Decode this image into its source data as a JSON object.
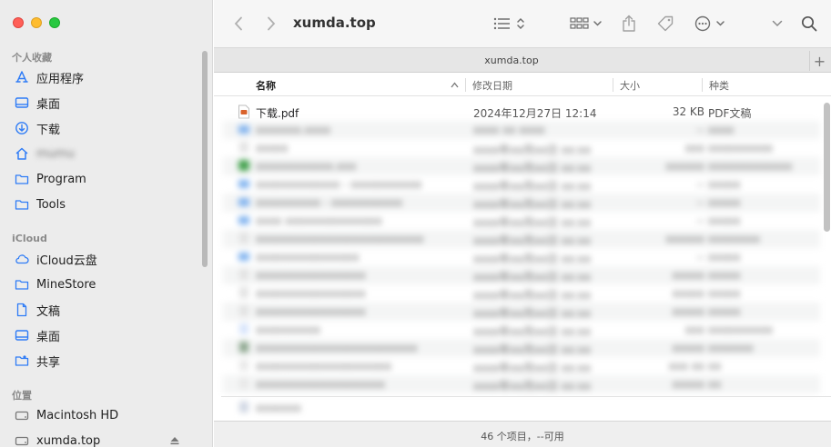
{
  "window": {
    "title": "xumda.top",
    "tab_title": "xumda.top",
    "status": "46 个项目，--可用"
  },
  "toolbar": {
    "back_icon": "chevron-left-icon",
    "forward_icon": "chevron-right-icon",
    "view_icon": "list-view-icon",
    "group_icon": "grid-group-icon",
    "share_icon": "share-icon",
    "tag_icon": "tag-icon",
    "action_icon": "ellipsis-circle-icon",
    "search_icon": "search-icon",
    "tab_add_label": "+"
  },
  "sidebar": {
    "favorites_header": "个人收藏",
    "favorites": [
      {
        "label": "应用程序",
        "icon": "applications-icon"
      },
      {
        "label": "桌面",
        "icon": "desktop-icon"
      },
      {
        "label": "下载",
        "icon": "download-icon"
      },
      {
        "label": "mumu",
        "icon": "home-icon"
      },
      {
        "label": "Program",
        "icon": "folder-icon"
      },
      {
        "label": "Tools",
        "icon": "folder-icon"
      }
    ],
    "icloud_header": "iCloud",
    "icloud": [
      {
        "label": "iCloud云盘",
        "icon": "cloud-icon"
      },
      {
        "label": "MineStore",
        "icon": "folder-icon"
      },
      {
        "label": "文稿",
        "icon": "document-icon"
      },
      {
        "label": "桌面",
        "icon": "desktop-icon"
      },
      {
        "label": "共享",
        "icon": "shared-folder-icon"
      }
    ],
    "locations_header": "位置",
    "locations": [
      {
        "label": "Macintosh HD",
        "icon": "disk-icon"
      },
      {
        "label": "xumda.top",
        "icon": "disk-icon"
      }
    ]
  },
  "columns": {
    "name": "名称",
    "date": "修改日期",
    "size": "大小",
    "kind": "种类"
  },
  "files": [
    {
      "name": "下载.pdf",
      "date": "2024年12月27日 12:14",
      "size": "32 KB",
      "kind": "PDF文稿"
    }
  ],
  "blurred_files": [
    {
      "name": "xxxxxxx.xxxx",
      "date": "xxxx xx xxxx",
      "size": "--",
      "kind": "xxxx"
    },
    {
      "name": "xxxxx",
      "date": "xxxx年xx月xx日 xx:xx",
      "size": "xxx",
      "kind": "xxxxxxxxxx"
    },
    {
      "name": "xxxxxxxxxxxx.xxx",
      "date": "xxxx年xx月xx日 xx:xx",
      "size": "xxxxxx",
      "kind": "xxxxxxxxxxxxx"
    },
    {
      "name": "xxxxxxxxxxxxx - xxxxxxxxxxx",
      "date": "xxxx年xx月xx日 xx:xx",
      "size": "--",
      "kind": "xxxxx"
    },
    {
      "name": "xxxxxxxxxx - xxxxxxxxxxx",
      "date": "xxxx年xx月xx日 xx:xx",
      "size": "--",
      "kind": "xxxxx"
    },
    {
      "name": "xxxx xxxxxxxxxxxxxxx",
      "date": "xxxx年xx月xx日 xx:xx",
      "size": "--",
      "kind": "xxxxx"
    },
    {
      "name": "xxxxxxxxxxxxxxxxxxxxxxxxxx",
      "date": "xxxx年xx月xx日 xx:xx",
      "size": "xxxxxx",
      "kind": "xxxxxxxx"
    },
    {
      "name": "xxxxxxxxxxxxxxxx",
      "date": "xxxx年xx月xx日 xx:xx",
      "size": "--",
      "kind": "xxxxx"
    },
    {
      "name": "xxxxxxxxxxxxxxxxx",
      "date": "xxxx年xx月xx日 xx:xx",
      "size": "xxxxx",
      "kind": "xxxxx"
    },
    {
      "name": "xxxxxxxxxxxxxxxxx",
      "date": "xxxx年xx月xx日 xx:xx",
      "size": "xxxxx",
      "kind": "xxxxx"
    },
    {
      "name": "xxxxxxxxxxxxxxxxx",
      "date": "xxxx年xx月xx日 xx:xx",
      "size": "xxxxx",
      "kind": "xxxxx"
    },
    {
      "name": "xxxxxxxxxx",
      "date": "xxxx年xx月xx日 xx:xx",
      "size": "xxx",
      "kind": "xxxxxxxxxx"
    },
    {
      "name": "xxxxxxxxxxxxxxxxxxxxxxxxx",
      "date": "xxxx年xx月xx日 xx:xx",
      "size": "xxxxx",
      "kind": "xxxxxxx"
    },
    {
      "name": "xxxxxxxxxxxxxxxxxxxxx",
      "date": "xxxx年xx月xx日 xx:xx",
      "size": "xxx xx",
      "kind": "xx"
    },
    {
      "name": "xxxxxxxxxxxxxxxxxxxx",
      "date": "xxxx年xx月xx日 xx:xx",
      "size": "xxxxx",
      "kind": "xx"
    },
    {
      "name": "xxxxxxx",
      "date": "",
      "size": "",
      "kind": ""
    }
  ],
  "colors": {
    "sidebar_bg": "#ececec",
    "accent_blue": "#2f7cf6",
    "row_alt": "#f4f5f5",
    "pdf_icon": "#d9622b"
  }
}
